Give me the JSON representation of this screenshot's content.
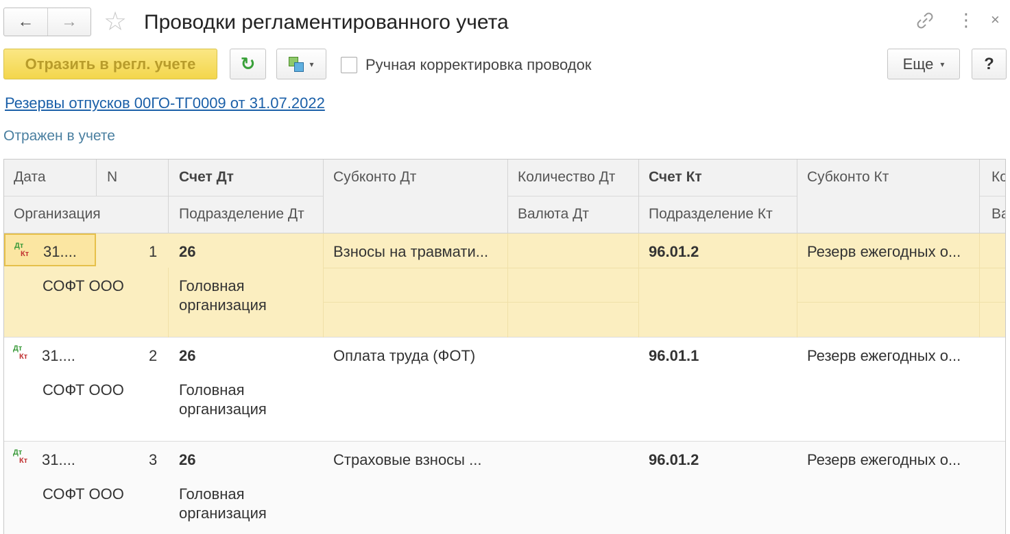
{
  "window": {
    "title": "Проводки регламентированного учета",
    "back_icon": "←",
    "forward_icon": "→",
    "favorite_icon": "☆",
    "link_icon": "🔗",
    "more_icon": "⋮",
    "close_icon": "×"
  },
  "toolbar": {
    "reflect_label": "Отразить в регл. учете",
    "refresh_icon": "↻",
    "manual_correction_label": "Ручная корректировка проводок",
    "more_label": "Еще",
    "more_caret": "▾",
    "structure_caret": "▾",
    "help_label": "?"
  },
  "document_link": "Резервы отпусков 00ГО-ТГ0009 от 31.07.2022",
  "status": "Отражен в учете",
  "table": {
    "headers": {
      "date": "Дата",
      "n": "N",
      "account_dt": "Счет Дт",
      "subconto_dt": "Субконто Дт",
      "qty_dt": "Количество Дт",
      "account_kt": "Счет Кт",
      "subconto_kt": "Субконто Кт",
      "qty_kt_partial": "Ко",
      "organization": "Организация",
      "division_dt": "Подразделение Дт",
      "currency_dt": "Валюта Дт",
      "division_kt": "Подразделение Кт",
      "currency_kt_partial": "Ва"
    },
    "rows": [
      {
        "dt_mark": "Дт",
        "kt_mark": "Кт",
        "date": "31....",
        "n": "1",
        "account_dt": "26",
        "subconto_dt": "Взносы на травмати...",
        "account_kt": "96.01.2",
        "subconto_kt": "Резерв ежегодных о...",
        "organization": "СОФТ ООО",
        "division_dt": "Головная организация"
      },
      {
        "dt_mark": "Дт",
        "kt_mark": "Кт",
        "date": "31....",
        "n": "2",
        "account_dt": "26",
        "subconto_dt": "Оплата труда (ФОТ)",
        "account_kt": "96.01.1",
        "subconto_kt": "Резерв ежегодных о...",
        "organization": "СОФТ ООО",
        "division_dt": "Головная организация"
      },
      {
        "dt_mark": "Дт",
        "kt_mark": "Кт",
        "date": "31....",
        "n": "3",
        "account_dt": "26",
        "subconto_dt": "Страховые взносы ...",
        "account_kt": "96.01.2",
        "subconto_kt": "Резерв ежегодных о...",
        "organization": "СОФТ ООО",
        "division_dt": "Головная организация"
      }
    ]
  },
  "colors": {
    "accent_yellow": "#f3d64c",
    "selected_row": "#fbeec0",
    "link_blue": "#1a5fa8"
  }
}
